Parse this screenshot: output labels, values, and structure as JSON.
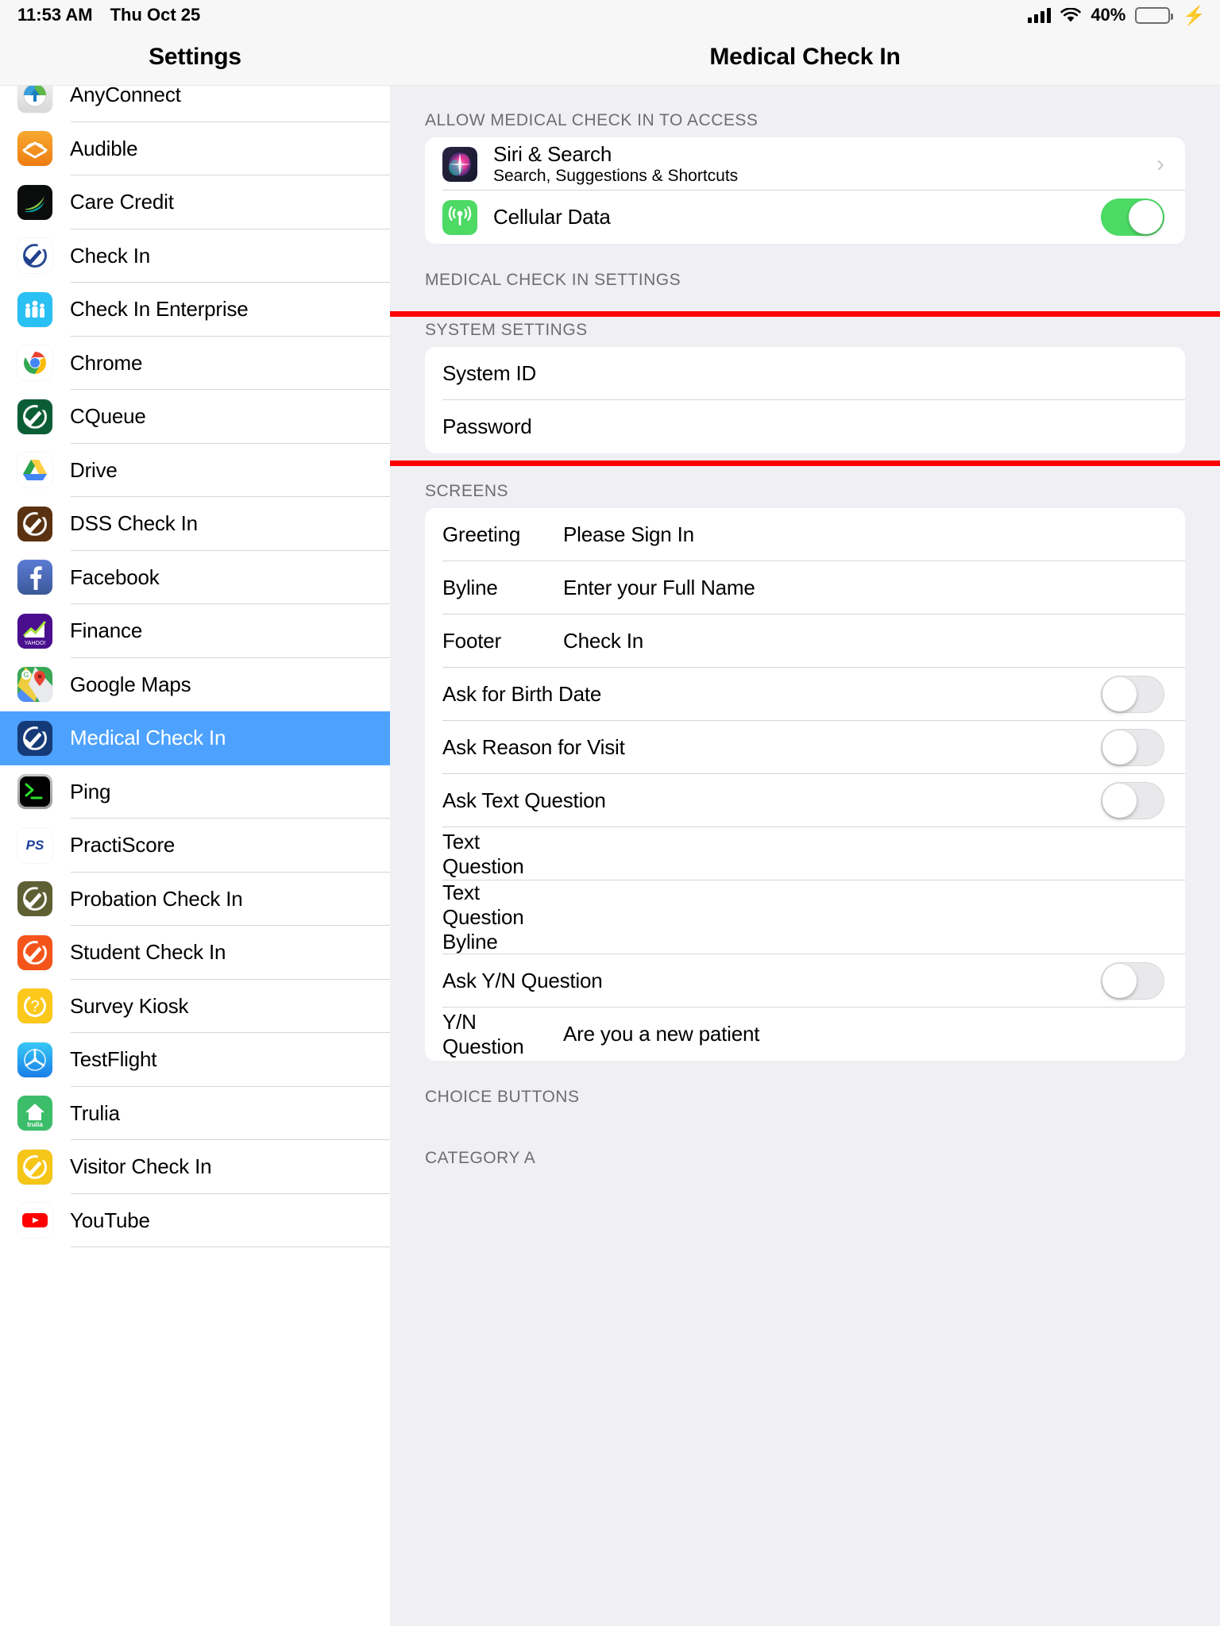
{
  "status_bar": {
    "time": "11:53 AM",
    "date": "Thu Oct 25",
    "battery_percent": "40%",
    "battery_level": 40,
    "signal_icon": "cellular-signal-icon",
    "wifi_icon": "wifi-icon",
    "charging_icon": "lightning-bolt-icon"
  },
  "sidebar": {
    "title": "Settings",
    "items": [
      {
        "label": "AnyConnect",
        "icon": "anyconnect-app-icon",
        "selected": false
      },
      {
        "label": "Audible",
        "icon": "audible-app-icon",
        "selected": false
      },
      {
        "label": "Care Credit",
        "icon": "care-credit-app-icon",
        "selected": false
      },
      {
        "label": "Check In",
        "icon": "check-in-app-icon",
        "selected": false
      },
      {
        "label": "Check In Enterprise",
        "icon": "check-in-enterprise-app-icon",
        "selected": false
      },
      {
        "label": "Chrome",
        "icon": "chrome-app-icon",
        "selected": false
      },
      {
        "label": "CQueue",
        "icon": "cqueue-app-icon",
        "selected": false
      },
      {
        "label": "Drive",
        "icon": "google-drive-app-icon",
        "selected": false
      },
      {
        "label": "DSS Check In",
        "icon": "dss-check-in-app-icon",
        "selected": false
      },
      {
        "label": "Facebook",
        "icon": "facebook-app-icon",
        "selected": false
      },
      {
        "label": "Finance",
        "icon": "yahoo-finance-app-icon",
        "selected": false
      },
      {
        "label": "Google Maps",
        "icon": "google-maps-app-icon",
        "selected": false
      },
      {
        "label": "Medical Check In",
        "icon": "medical-check-in-app-icon",
        "selected": true
      },
      {
        "label": "Ping",
        "icon": "ping-terminal-app-icon",
        "selected": false
      },
      {
        "label": "PractiScore",
        "icon": "practiscore-app-icon",
        "selected": false
      },
      {
        "label": "Probation Check In",
        "icon": "probation-check-in-app-icon",
        "selected": false
      },
      {
        "label": "Student Check In",
        "icon": "student-check-in-app-icon",
        "selected": false
      },
      {
        "label": "Survey Kiosk",
        "icon": "survey-kiosk-app-icon",
        "selected": false
      },
      {
        "label": "TestFlight",
        "icon": "testflight-app-icon",
        "selected": false
      },
      {
        "label": "Trulia",
        "icon": "trulia-app-icon",
        "selected": false
      },
      {
        "label": "Visitor Check In",
        "icon": "visitor-check-in-app-icon",
        "selected": false
      },
      {
        "label": "YouTube",
        "icon": "youtube-app-icon",
        "selected": false
      }
    ]
  },
  "detail": {
    "title": "Medical Check In",
    "sections": {
      "allow_access": {
        "header": "ALLOW MEDICAL CHECK IN TO ACCESS",
        "rows": [
          {
            "title": "Siri & Search",
            "subtitle": "Search, Suggestions & Shortcuts",
            "icon": "siri-icon",
            "accessory": "chevron"
          },
          {
            "title": "Cellular Data",
            "icon": "cellular-data-icon",
            "accessory": "toggle",
            "toggle_on": true
          }
        ]
      },
      "medical_check_in_settings": {
        "header": "MEDICAL CHECK IN SETTINGS"
      },
      "system_settings": {
        "header": "SYSTEM SETTINGS",
        "rows": [
          {
            "title": "System ID",
            "value": ""
          },
          {
            "title": "Password",
            "value": ""
          }
        ]
      },
      "screens": {
        "header": "SCREENS",
        "rows": [
          {
            "title": "Greeting",
            "value": "Please Sign In",
            "accessory": "value"
          },
          {
            "title": "Byline",
            "value": "Enter your Full Name",
            "accessory": "value"
          },
          {
            "title": "Footer",
            "value": "Check In",
            "accessory": "value"
          },
          {
            "title": "Ask for Birth Date",
            "accessory": "toggle",
            "toggle_on": false
          },
          {
            "title": "Ask Reason for Visit",
            "accessory": "toggle",
            "toggle_on": false
          },
          {
            "title": "Ask Text Question",
            "accessory": "toggle",
            "toggle_on": false
          },
          {
            "title": "Text Question",
            "value": "",
            "accessory": "value"
          },
          {
            "title": "Text Question Byline",
            "value": "",
            "accessory": "value"
          },
          {
            "title": "Ask Y/N Question",
            "accessory": "toggle",
            "toggle_on": false
          },
          {
            "title": "Y/N Question",
            "value": "Are you a new patient",
            "accessory": "value"
          }
        ]
      },
      "choice_buttons": {
        "header": "CHOICE BUTTONS"
      },
      "category_a": {
        "header": "CATEGORY A"
      }
    }
  },
  "annotation": {
    "highlight_color": "#ff0000",
    "label": "system-settings-highlight"
  },
  "colors": {
    "selection_blue": "#4da2ff",
    "toggle_on_green": "#4cd964",
    "group_background": "#efeff4",
    "card_background": "#ffffff",
    "header_text": "#6d6d72"
  }
}
